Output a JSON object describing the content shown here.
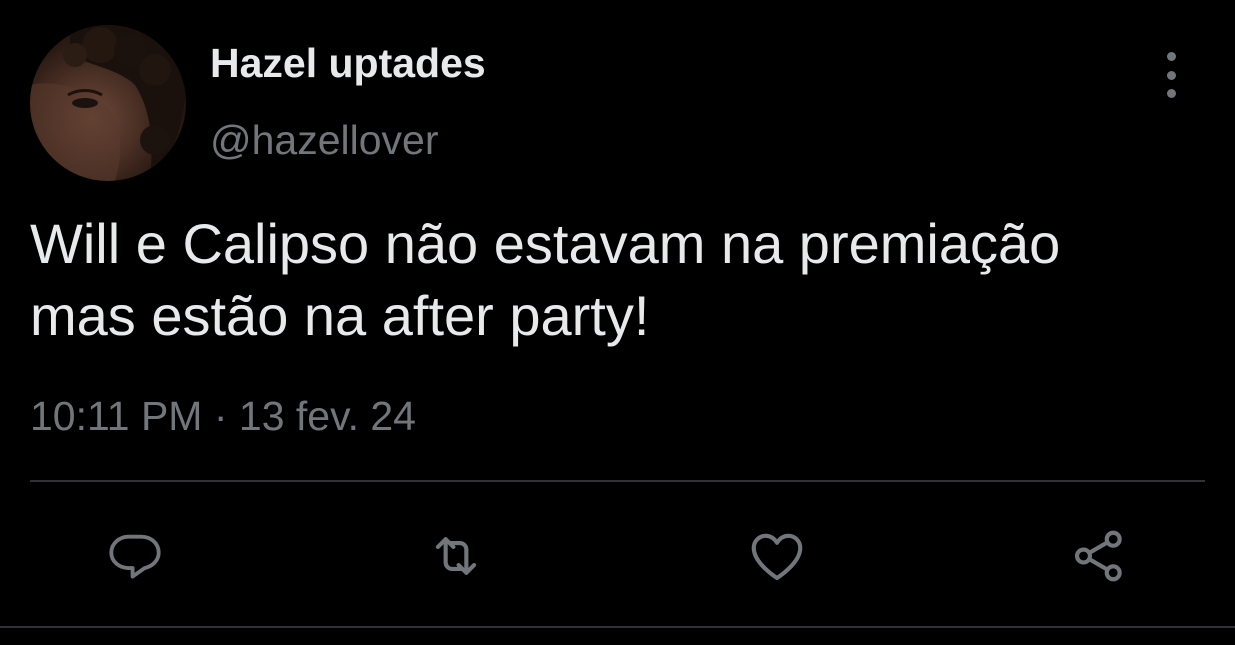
{
  "tweet": {
    "display_name": "Hazel uptades",
    "handle": "@hazellover",
    "text_line1": "Will e Calipso não estavam na premiação",
    "text_line2": "mas estão na after party!",
    "time": "10:11 PM",
    "separator": "·",
    "date": "13 fev. 24"
  },
  "actions": {
    "reply_icon": "reply-icon",
    "retweet_icon": "retweet-icon",
    "like_icon": "heart-icon",
    "share_icon": "share-icon"
  },
  "colors": {
    "background": "#000000",
    "primary_text": "#e7e9ea",
    "secondary_text": "#71767b",
    "divider": "#2f3336"
  }
}
